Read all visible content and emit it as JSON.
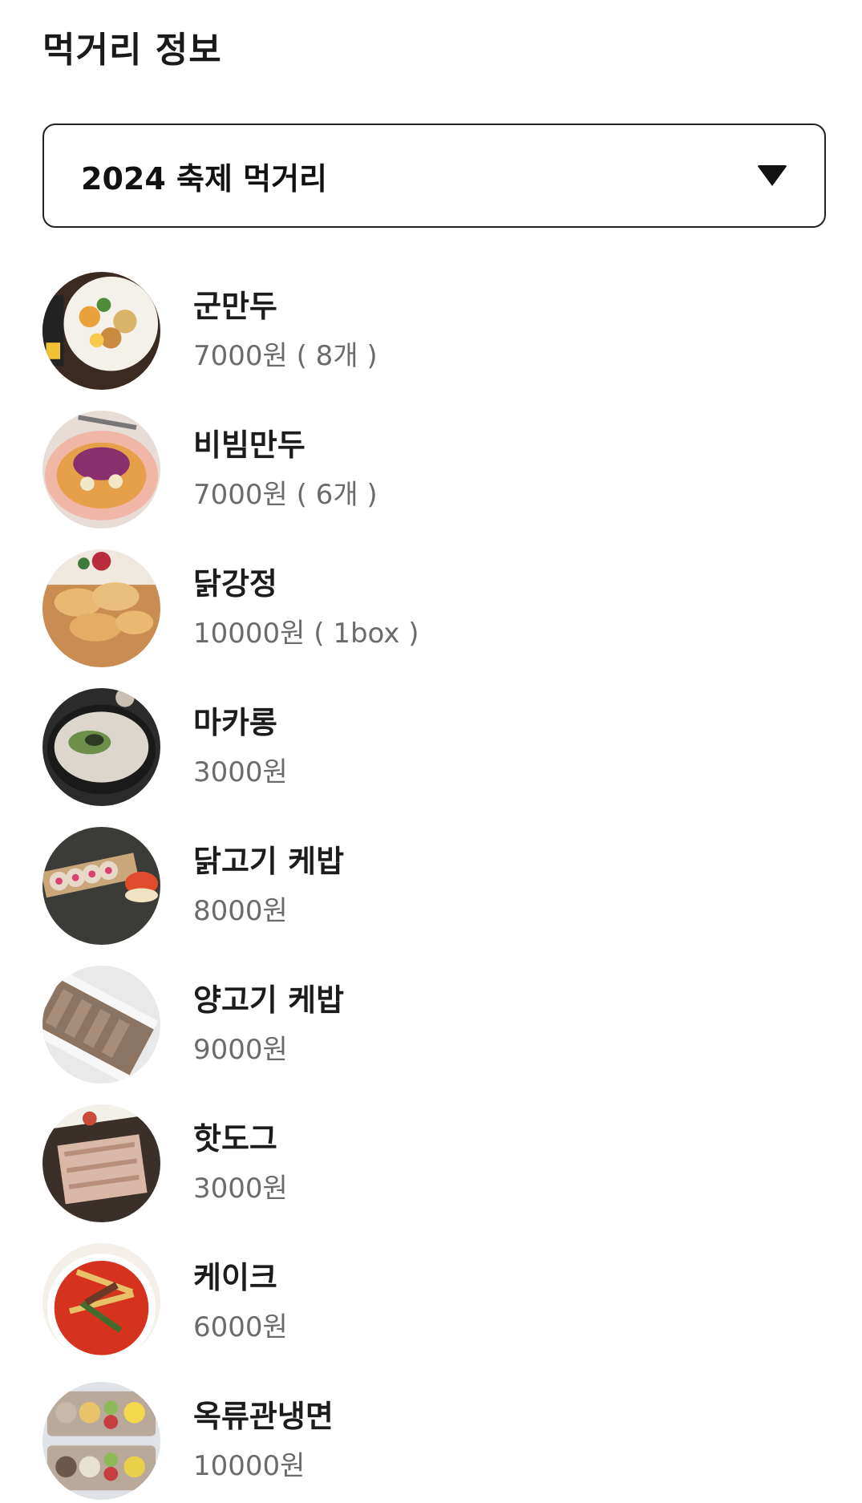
{
  "header": {
    "title": "먹거리 정보"
  },
  "dropdown": {
    "selected": "2024 축제 먹거리"
  },
  "menu": [
    {
      "name": "군만두",
      "price": "7000원 ( 8개 )",
      "icon": "food-photo-icon"
    },
    {
      "name": "비빔만두",
      "price": "7000원 ( 6개 )",
      "icon": "food-photo-icon"
    },
    {
      "name": "닭강정",
      "price": "10000원 ( 1box )",
      "icon": "food-photo-icon"
    },
    {
      "name": "마카롱",
      "price": "3000원",
      "icon": "food-photo-icon"
    },
    {
      "name": "닭고기 케밥",
      "price": "8000원",
      "icon": "food-photo-icon"
    },
    {
      "name": "양고기 케밥",
      "price": "9000원",
      "icon": "food-photo-icon"
    },
    {
      "name": "핫도그",
      "price": "3000원",
      "icon": "food-photo-icon"
    },
    {
      "name": "케이크",
      "price": "6000원",
      "icon": "food-photo-icon"
    },
    {
      "name": "옥류관냉면",
      "price": "10000원",
      "icon": "food-photo-icon"
    }
  ],
  "colors": {
    "text_primary": "#1c1c1c",
    "text_secondary": "#6b6b6b",
    "border": "#222222"
  }
}
